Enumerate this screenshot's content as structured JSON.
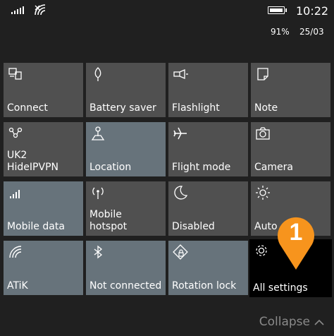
{
  "status": {
    "time": "10:22",
    "battery_percent": "91%",
    "date": "25/03",
    "battery_level": 0.91
  },
  "tiles": [
    {
      "label": "Connect",
      "icon": "connect-icon",
      "active": false
    },
    {
      "label": "Battery saver",
      "icon": "battery-saver-icon",
      "active": false
    },
    {
      "label": "Flashlight",
      "icon": "flashlight-icon",
      "active": false
    },
    {
      "label": "Note",
      "icon": "note-icon",
      "active": false
    },
    {
      "label": "UK2\nHideIPVPN",
      "icon": "vpn-icon",
      "active": false
    },
    {
      "label": "Location",
      "icon": "location-icon",
      "active": true
    },
    {
      "label": "Flight mode",
      "icon": "airplane-icon",
      "active": false
    },
    {
      "label": "Camera",
      "icon": "camera-icon",
      "active": false
    },
    {
      "label": "Mobile data",
      "icon": "mobile-data-icon",
      "active": true
    },
    {
      "label": "Mobile\nhotspot",
      "icon": "hotspot-icon",
      "active": false
    },
    {
      "label": "Disabled",
      "icon": "moon-icon",
      "active": false
    },
    {
      "label": "Auto",
      "icon": "brightness-icon",
      "active": false
    },
    {
      "label": "ATiK",
      "icon": "wifi-icon",
      "active": true
    },
    {
      "label": "Not connected",
      "icon": "bluetooth-icon",
      "active": true
    },
    {
      "label": "Rotation lock",
      "icon": "rotation-lock-icon",
      "active": true
    },
    {
      "label": "All settings",
      "icon": "gear-icon",
      "active": false
    }
  ],
  "collapse_label": "Collapse",
  "annotation": {
    "number": "1",
    "color": "#f7941d"
  },
  "colors": {
    "background": "#202020",
    "tile": "#505050",
    "tile_active": "#67737b",
    "highlight": "#000000"
  }
}
